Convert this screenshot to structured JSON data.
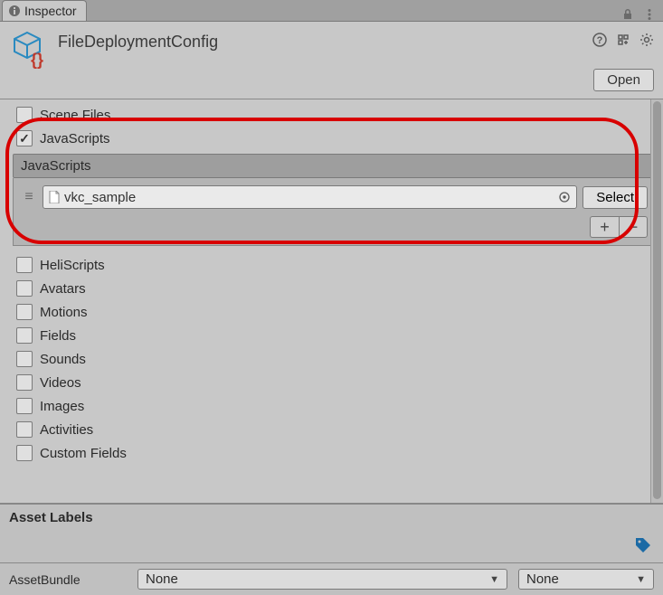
{
  "tab": {
    "label": "Inspector"
  },
  "header": {
    "asset_name": "FileDeploymentConfig",
    "open_button": "Open"
  },
  "sections": {
    "scene_files": {
      "label": "Scene Files",
      "checked": false
    },
    "javascripts": {
      "label": "JavaScripts",
      "checked": true
    },
    "javascripts_list": {
      "header": "JavaScripts",
      "items": [
        {
          "value": "vkc_sample"
        }
      ],
      "select_button": "Select"
    },
    "heliscripts": {
      "label": "HeliScripts",
      "checked": false
    },
    "avatars": {
      "label": "Avatars",
      "checked": false
    },
    "motions": {
      "label": "Motions",
      "checked": false
    },
    "fields": {
      "label": "Fields",
      "checked": false
    },
    "sounds": {
      "label": "Sounds",
      "checked": false
    },
    "videos": {
      "label": "Videos",
      "checked": false
    },
    "images": {
      "label": "Images",
      "checked": false
    },
    "activities": {
      "label": "Activities",
      "checked": false
    },
    "custom_fields": {
      "label": "Custom Fields",
      "checked": false
    }
  },
  "footer": {
    "asset_labels_title": "Asset Labels",
    "asset_bundle_label": "AssetBundle",
    "bundle_value": "None",
    "variant_value": "None"
  }
}
